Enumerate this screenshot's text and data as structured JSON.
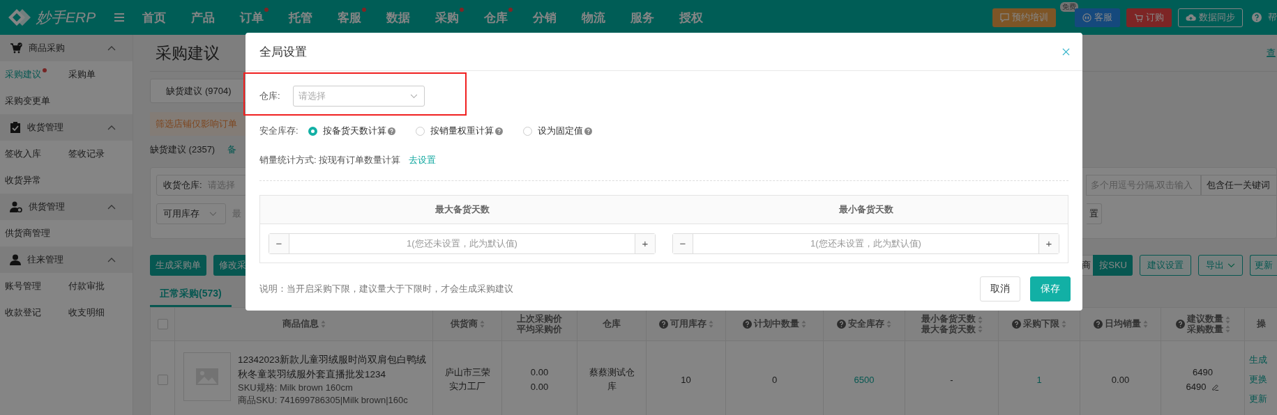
{
  "topbar": {
    "logo": "妙手ERP",
    "nav": [
      {
        "label": "首页",
        "dot": false
      },
      {
        "label": "产品",
        "dot": false
      },
      {
        "label": "订单",
        "dot": true
      },
      {
        "label": "托管",
        "dot": false
      },
      {
        "label": "客服",
        "dot": true
      },
      {
        "label": "数据",
        "dot": false
      },
      {
        "label": "采购",
        "dot": true
      },
      {
        "label": "仓库",
        "dot": true
      },
      {
        "label": "分销",
        "dot": false
      },
      {
        "label": "物流",
        "dot": false
      },
      {
        "label": "服务",
        "dot": false
      },
      {
        "label": "授权",
        "dot": false
      }
    ],
    "actions": [
      {
        "label": "预约培训",
        "kind": "training",
        "badge": "免费"
      },
      {
        "label": "客服",
        "kind": "service"
      },
      {
        "label": "订购",
        "kind": "order"
      },
      {
        "label": "数据同步",
        "kind": "sync"
      }
    ],
    "help": "帮"
  },
  "sidebar": {
    "groups": [
      {
        "title": "商品采购",
        "expanded": true,
        "items": [
          {
            "label": "采购建议",
            "selected": true,
            "dot": true
          },
          {
            "label": "采购单",
            "selected": false,
            "dot": false
          },
          {
            "label": "采购变更单",
            "selected": false,
            "dot": false
          }
        ]
      },
      {
        "title": "收货管理",
        "expanded": true,
        "items": [
          {
            "label": "签收入库",
            "selected": false,
            "dot": false
          },
          {
            "label": "签收记录",
            "selected": false,
            "dot": false
          },
          {
            "label": "收货异常",
            "selected": false,
            "dot": false
          }
        ]
      },
      {
        "title": "供货管理",
        "expanded": true,
        "items": [
          {
            "label": "供货商管理",
            "selected": false,
            "dot": false
          }
        ]
      },
      {
        "title": "往来管理",
        "expanded": true,
        "items": [
          {
            "label": "账号管理",
            "selected": false,
            "dot": false
          },
          {
            "label": "付款审批",
            "selected": false,
            "dot": false
          },
          {
            "label": "收款登记",
            "selected": false,
            "dot": false
          },
          {
            "label": "收支明细",
            "selected": false,
            "dot": false
          }
        ]
      }
    ]
  },
  "page": {
    "title": "采购建议",
    "top_link": "查",
    "suggestion_tab": "缺货建议 (9704)",
    "notice": "筛选店铺仅影响订单",
    "count": "缺货建议 (2357)",
    "count_link": "备",
    "filters": {
      "warehouse_label": "收货仓库:",
      "warehouse_placeholder": "请选择",
      "stock_select": "可用库存",
      "min_label": "最",
      "keyword_placeholder": "多个用逗号分隔,双击输入",
      "keyword_mode": "包含任一关键词",
      "reset": "置"
    },
    "left_buttons": [
      "生成采购单",
      "修改采"
    ],
    "group_toggle": [
      {
        "label": "商",
        "selected": false
      },
      {
        "label": "按SKU",
        "selected": true
      }
    ],
    "right_buttons": [
      {
        "label": "建议设置",
        "dropdown": false
      },
      {
        "label": "导出",
        "dropdown": true
      },
      {
        "label": "更新",
        "dropdown": false
      }
    ],
    "tabs": [
      {
        "label": "正常采购(573)",
        "selected": true
      }
    ],
    "table": {
      "columns": [
        {
          "kind": "checkbox",
          "checked": false
        },
        {
          "kind": "text",
          "lines": [
            "商品信息"
          ],
          "help": false,
          "sort": true
        },
        {
          "kind": "text",
          "lines": [
            "供货商"
          ],
          "help": false,
          "sort": true
        },
        {
          "kind": "text",
          "lines": [
            "上次采购价",
            "平均采购价"
          ],
          "help": false,
          "sort": false
        },
        {
          "kind": "text",
          "lines": [
            "仓库"
          ],
          "help": false,
          "sort": false
        },
        {
          "kind": "text",
          "lines": [
            "可用库存"
          ],
          "help": true,
          "sort": true
        },
        {
          "kind": "text",
          "lines": [
            "计划中数量"
          ],
          "help": true,
          "sort": true
        },
        {
          "kind": "text",
          "lines": [
            "安全库存"
          ],
          "help": true,
          "sort": true
        },
        {
          "kind": "text",
          "lines": [
            "最小备货天数",
            "最大备货天数"
          ],
          "help": false,
          "sort": true
        },
        {
          "kind": "text",
          "lines": [
            "采购下限"
          ],
          "help": true,
          "sort": true
        },
        {
          "kind": "text",
          "lines": [
            "日均销量"
          ],
          "help": true,
          "sort": true
        },
        {
          "kind": "text",
          "lines": [
            "建议数量",
            "采购数量"
          ],
          "help": true,
          "sort": true
        },
        {
          "kind": "text",
          "lines": [
            "操"
          ],
          "help": false,
          "sort": false
        }
      ],
      "rows": [
        {
          "checked": false,
          "title": "12342023新款儿童羽绒服时尚双肩包白鸭绒秋冬童装羽绒服外套直播批发1234",
          "spec": "SKU规格:  Milk brown 160cm",
          "sku": "商品SKU:  741699786305|Milk brown|160c",
          "supplier": "庐山市三荣实力工厂",
          "last_price": "0.00",
          "avg_price": "0.00",
          "warehouse": "蔡蔡测试仓库",
          "available": "10",
          "planned": "0",
          "safety": "6500",
          "days": "-",
          "min_purchase": "1",
          "daily_sales": "0.00",
          "suggested": "6490",
          "purchase": "6490",
          "actions": [
            "生成",
            "更换",
            "更新"
          ]
        }
      ]
    }
  },
  "dialog": {
    "title": "全局设置",
    "warehouse": {
      "label": "仓库:",
      "placeholder": "请选择",
      "highlighted": true
    },
    "safety_stock": {
      "label": "安全库存:",
      "options": [
        {
          "label": "按备货天数计算",
          "selected": true
        },
        {
          "label": "按销量权重计算",
          "selected": false
        },
        {
          "label": "设为固定值",
          "selected": false
        }
      ]
    },
    "sales_method": {
      "text": "销量统计方式: 按现有订单数量计算",
      "link": "去设置"
    },
    "days_table": [
      {
        "header": "最大备货天数",
        "placeholder": "1(您还未设置，此为默认值)",
        "minus": "−",
        "plus": "+"
      },
      {
        "header": "最小备货天数",
        "placeholder": "1(您还未设置，此为默认值)",
        "minus": "−",
        "plus": "+"
      }
    ],
    "note": "说明：当开启采购下限，建议量大于下限时，才会生成采购建议",
    "buttons": [
      {
        "label": "取消",
        "kind": "secondary"
      },
      {
        "label": "保存",
        "kind": "primary"
      }
    ]
  }
}
